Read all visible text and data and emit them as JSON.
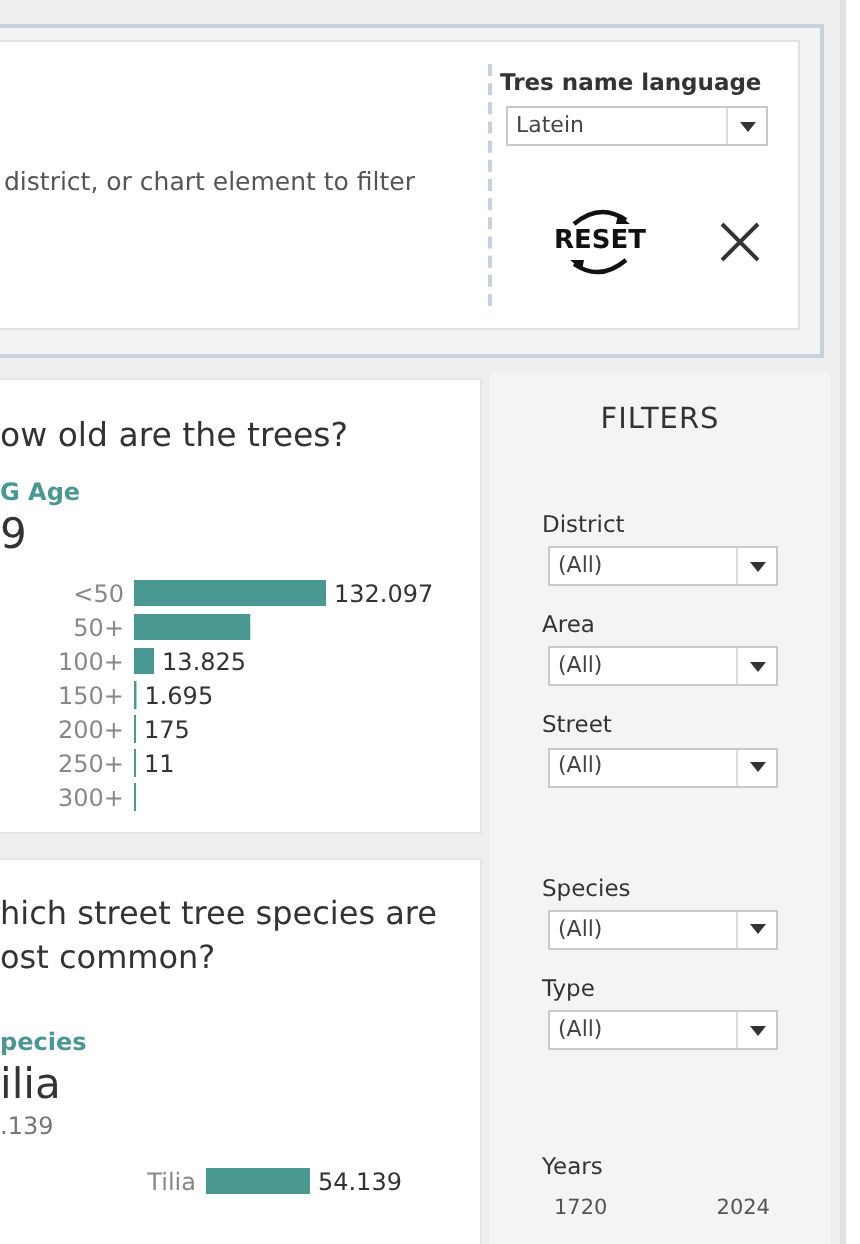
{
  "header": {
    "instruction": "district, or chart element to filter",
    "language_filter": {
      "label": "Tres name language",
      "value": "Latein"
    },
    "reset_label": "RESET"
  },
  "age_card": {
    "title": "ow old are the trees?",
    "kpi_label": "G Age",
    "kpi_value": "9",
    "chart_data": {
      "type": "bar",
      "orientation": "horizontal",
      "categories": [
        "<50",
        "50+",
        "100+",
        "150+",
        "200+",
        "250+",
        "300+"
      ],
      "values": [
        132097,
        80000,
        13825,
        1695,
        175,
        11,
        0
      ],
      "value_labels": [
        "132.097",
        null,
        "13.825",
        "1.695",
        "175",
        "11",
        null
      ],
      "xlim": [
        0,
        132097
      ]
    }
  },
  "species_card": {
    "title_lines": [
      "hich street tree species are",
      "ost common?"
    ],
    "kpi_label": "pecies",
    "kpi_value": "ilia",
    "kpi_count": ".139",
    "chart_data": {
      "type": "bar",
      "orientation": "horizontal",
      "categories": [
        "Tilia"
      ],
      "values": [
        54139
      ],
      "value_labels": [
        "54.139"
      ]
    }
  },
  "filters": {
    "title": "FILTERS",
    "groups": [
      [
        {
          "label": "District",
          "value": "(All)"
        },
        {
          "label": "Area",
          "value": "(All)"
        },
        {
          "label": "Street",
          "value": "(All)"
        }
      ],
      [
        {
          "label": "Species",
          "value": "(All)"
        },
        {
          "label": "Type",
          "value": "(All)"
        }
      ]
    ],
    "years": {
      "label": "Years",
      "min": "1720",
      "max": "2024"
    }
  }
}
